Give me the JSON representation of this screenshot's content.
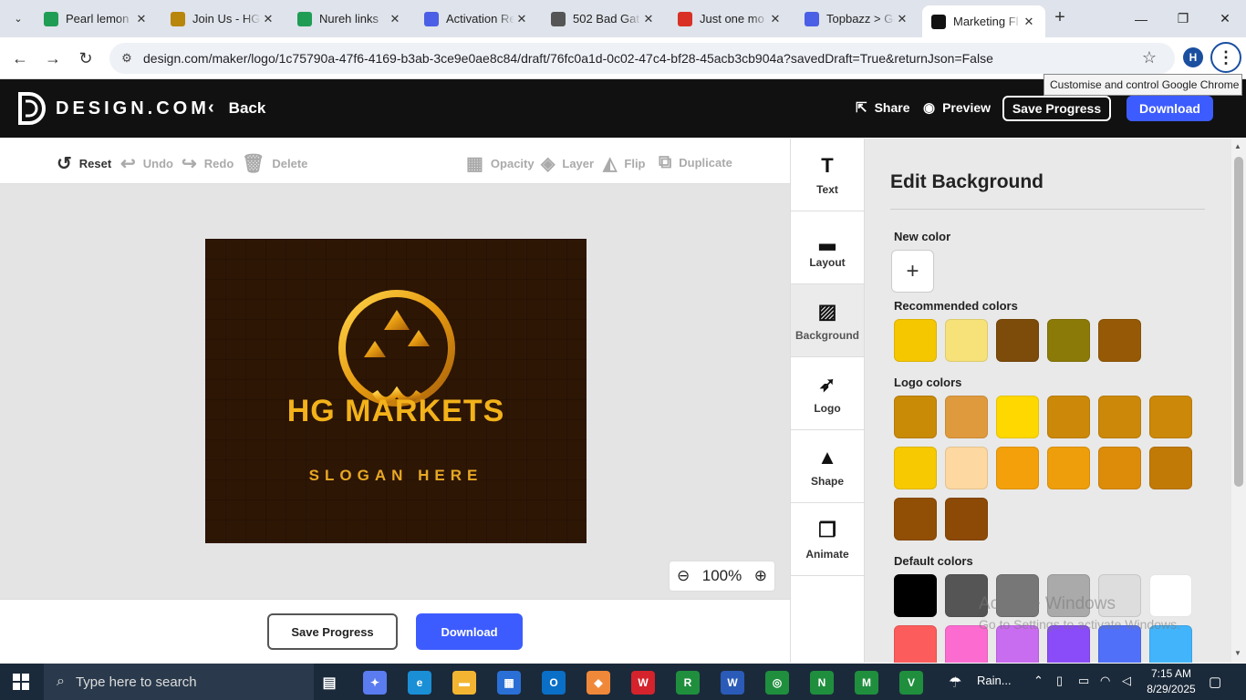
{
  "browser": {
    "tabs": [
      {
        "title": "Pearl lemon",
        "favicon": "sheets-icon",
        "color": "#1f9d55"
      },
      {
        "title": "Join Us - HG",
        "favicon": "gold-logo-icon",
        "color": "#b8860b"
      },
      {
        "title": "Nureh links",
        "favicon": "sheets-icon",
        "color": "#1f9d55"
      },
      {
        "title": "Activation Re",
        "favicon": "dollar-icon",
        "color": "#4b5ee6"
      },
      {
        "title": "502 Bad Gat",
        "favicon": "globe-icon",
        "color": "#555555"
      },
      {
        "title": "Just one mo",
        "favicon": "gmail-icon",
        "color": "#d93025"
      },
      {
        "title": "Topbazz > Ge",
        "favicon": "dollar-icon",
        "color": "#4b5ee6"
      },
      {
        "title": "Marketing Fl",
        "favicon": "design-icon",
        "color": "#111111"
      }
    ],
    "url": "design.com/maker/logo/1c75790a-47f6-4169-b3ab-3ce9e0ae8c84/draft/76fc0a1d-0c02-47c4-bf28-45acb3cb904a?savedDraft=True&returnJson=False",
    "profile_initial": "H",
    "tooltip": "Customise and control Google Chrome"
  },
  "header": {
    "brand": "DESIGN.COM",
    "back": "Back",
    "share": "Share",
    "preview": "Preview",
    "save": "Save Progress",
    "download": "Download"
  },
  "toolbar": {
    "reset": "Reset",
    "undo": "Undo",
    "redo": "Redo",
    "delete": "Delete",
    "opacity": "Opacity",
    "layer": "Layer",
    "flip": "Flip",
    "duplicate": "Duplicate"
  },
  "canvas": {
    "brand_name": "HG MARKETS",
    "slogan": "SLOGAN HERE",
    "zoom": "100%"
  },
  "bottom": {
    "save": "Save Progress",
    "download": "Download"
  },
  "side_tabs": [
    "Text",
    "Layout",
    "Background",
    "Logo",
    "Shape",
    "Animate"
  ],
  "panel": {
    "title": "Edit Background",
    "new_color": "New color",
    "recommended": "Recommended colors",
    "logo_colors": "Logo colors",
    "default_colors": "Default colors",
    "recommended_swatches": [
      "#f5c700",
      "#f7e27a",
      "#7d4b0a",
      "#8c7a08",
      "#965a06"
    ],
    "logo_swatches": [
      [
        "#c98a06",
        "#e09a3e",
        "#ffd800",
        "#cc8808",
        "#cc8808",
        "#cc8808"
      ],
      [
        "#f7c900",
        "#fdd8a0",
        "#f3a00a",
        "#ee9e0b",
        "#dc8c08",
        "#c27a06"
      ],
      [
        "#914f06",
        "#8c4a06"
      ]
    ],
    "default_swatches": [
      [
        "#000000",
        "#555555",
        "#777777",
        "#aaaaaa",
        "#dddddd",
        "#ffffff"
      ],
      [
        "#fd5c5c",
        "#fc6bd0",
        "#c86cf0",
        "#8a4cf8",
        "#5070fa",
        "#42b4fb"
      ]
    ],
    "watermark": "Activate Windows",
    "watermark_sub": "Go to Settings to activate Windows."
  },
  "taskbar": {
    "search_placeholder": "Type here to search",
    "weather": "Rain...",
    "time": "7:15 AM",
    "date": "8/29/2025"
  }
}
